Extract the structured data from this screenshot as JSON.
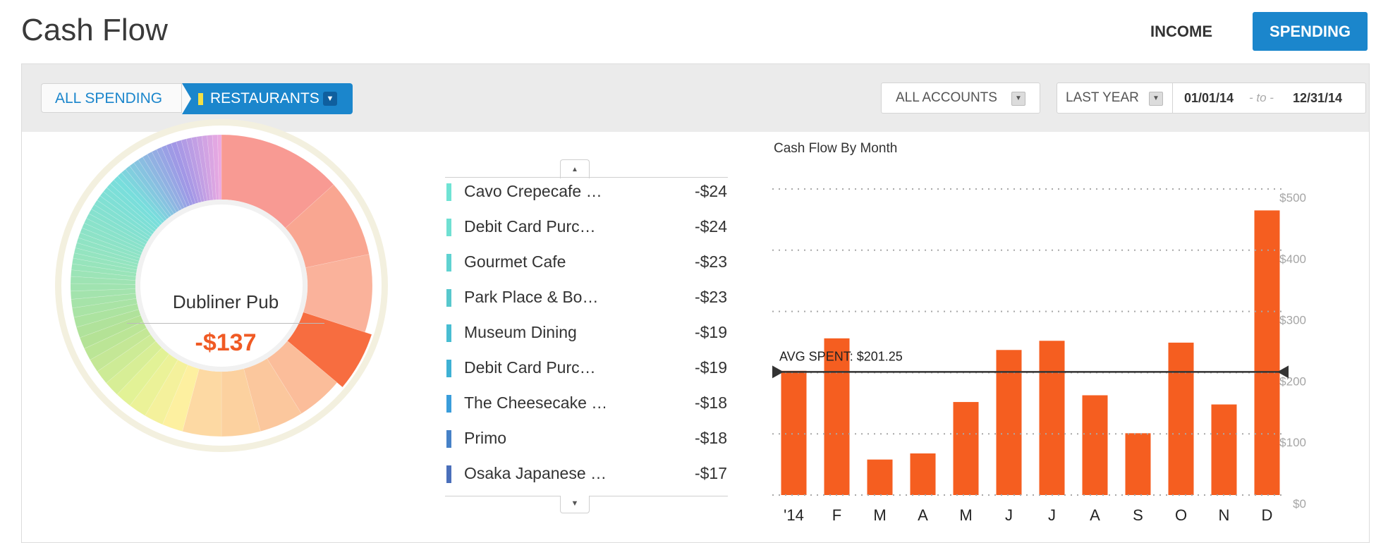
{
  "header": {
    "title": "Cash Flow",
    "tabs": {
      "income": "INCOME",
      "spending": "SPENDING"
    }
  },
  "filters": {
    "breadcrumb": {
      "all": "ALL SPENDING",
      "current": "RESTAURANTS",
      "current_color": "#f3e045"
    },
    "accounts": "ALL ACCOUNTS",
    "period": "LAST YEAR",
    "date_from": "01/01/14",
    "date_sep": "- to -",
    "date_to": "12/31/14"
  },
  "donut": {
    "selected_name": "Dubliner Pub",
    "selected_amount": "-$137"
  },
  "merchants": [
    {
      "name": "Cavo Crepecafe …",
      "amount": "-$24",
      "color": "#6fe3d4"
    },
    {
      "name": "Debit Card Purc…",
      "amount": "-$24",
      "color": "#6fe0d2"
    },
    {
      "name": "Gourmet Cafe",
      "amount": "-$23",
      "color": "#5fd2d1"
    },
    {
      "name": "Park Place & Bo…",
      "amount": "-$23",
      "color": "#57c8cd"
    },
    {
      "name": "Museum Dining",
      "amount": "-$19",
      "color": "#48bdd2"
    },
    {
      "name": "Debit Card Purc…",
      "amount": "-$19",
      "color": "#3eb1d4"
    },
    {
      "name": "The Cheesecake …",
      "amount": "-$18",
      "color": "#3a9ddb"
    },
    {
      "name": "Primo",
      "amount": "-$18",
      "color": "#4681c7"
    },
    {
      "name": "Osaka Japanese …",
      "amount": "-$17",
      "color": "#4a6fba"
    }
  ],
  "chart_data": {
    "type": "bar",
    "title": "Cash Flow By Month",
    "categories": [
      "'14",
      "F",
      "M",
      "A",
      "M",
      "J",
      "J",
      "A",
      "S",
      "O",
      "N",
      "D"
    ],
    "values": [
      203,
      256,
      58,
      68,
      152,
      237,
      252,
      163,
      101,
      249,
      148,
      465
    ],
    "ylim": [
      0,
      500
    ],
    "yticks": [
      0,
      100,
      200,
      300,
      400,
      500
    ],
    "ytick_labels": [
      "$0",
      "$100",
      "$200",
      "$300",
      "$400",
      "$500"
    ],
    "average": 201.25,
    "average_label": "AVG SPENT: $201.25",
    "bar_color": "#f55e20",
    "grid": true
  }
}
